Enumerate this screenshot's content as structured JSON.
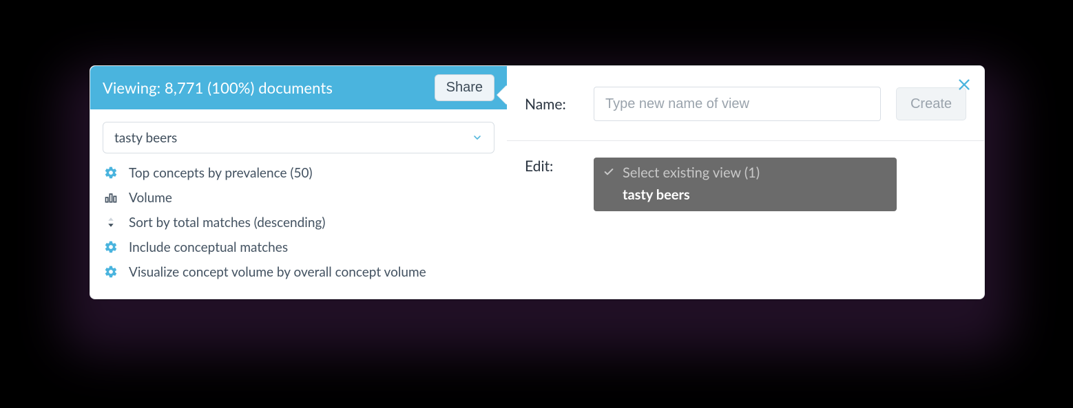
{
  "left": {
    "viewing_text": "Viewing: 8,771 (100%) documents",
    "share_label": "Share",
    "selected_view": "tasty beers",
    "config": {
      "top_concepts": "Top concepts by prevalence (50)",
      "volume_heading": "Volume",
      "sort": "Sort by total matches (descending)",
      "include": "Include conceptual matches",
      "visualize": "Visualize concept volume by overall concept volume"
    }
  },
  "right": {
    "name_label": "Name:",
    "name_placeholder": "Type new name of view",
    "create_label": "Create",
    "edit_label": "Edit:",
    "edit_placeholder": "Select existing view (1)",
    "edit_options": [
      "tasty beers"
    ]
  }
}
